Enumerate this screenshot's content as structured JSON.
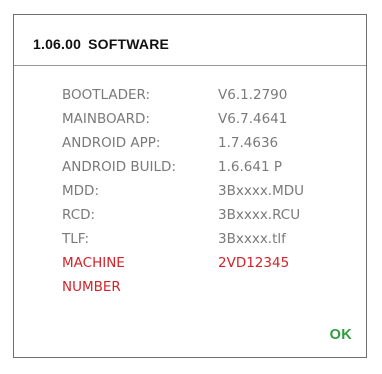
{
  "dialog": {
    "version": "1.06.00",
    "title": "SOFTWARE",
    "ok_label": "OK",
    "accent_color": "#d2232a",
    "ok_color": "#2e9c3f"
  },
  "info": [
    {
      "label": "BOOTLADER:",
      "value": "V6.1.2790"
    },
    {
      "label": "MAINBOARD:",
      "value": "V6.7.4641"
    },
    {
      "label": "ANDROID APP:",
      "value": "1.7.4636"
    },
    {
      "label": "ANDROID BUILD:",
      "value": "1.6.641 P"
    },
    {
      "label": "MDD:",
      "value": "3Bxxxx.MDU"
    },
    {
      "label": "RCD:",
      "value": "3Bxxxx.RCU"
    },
    {
      "label": "TLF:",
      "value": "3Bxxxx.tlf"
    }
  ],
  "machine": {
    "label_line1": "MACHINE",
    "label_line2": "NUMBER",
    "value": "2VD12345"
  }
}
